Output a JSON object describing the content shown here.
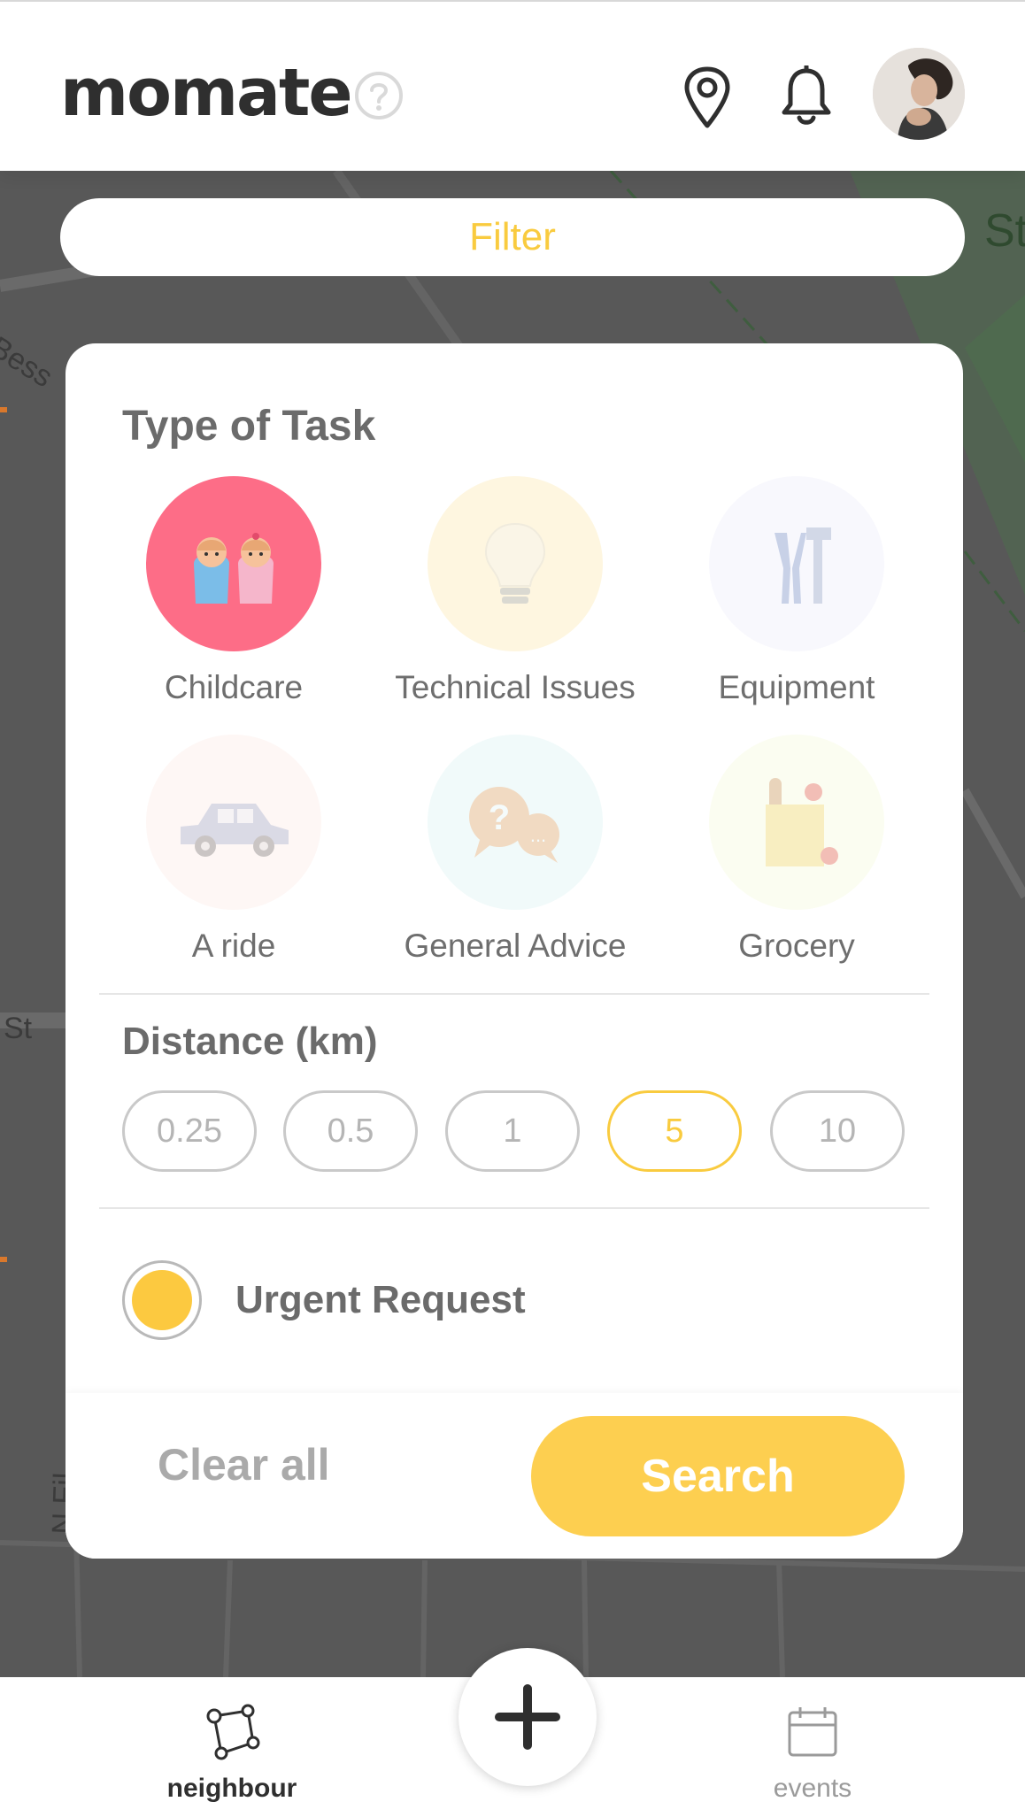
{
  "header": {
    "logo": "momate",
    "icons": [
      "help-icon",
      "location-pin-icon",
      "bell-icon",
      "avatar"
    ]
  },
  "map": {
    "labels": [
      "Bess",
      "St",
      "St",
      "N Fil"
    ]
  },
  "filter_bar": {
    "label": "Filter"
  },
  "filter_card": {
    "type_title": "Type of Task",
    "tasks": [
      {
        "label": "Childcare",
        "icon": "twin-babies-icon",
        "selected": true
      },
      {
        "label": "Technical Issues",
        "icon": "lightbulb-icon",
        "selected": false
      },
      {
        "label": "Equipment",
        "icon": "tools-icon",
        "selected": false
      },
      {
        "label": "A ride",
        "icon": "car-icon",
        "selected": false
      },
      {
        "label": "General Advice",
        "icon": "speech-bubbles-icon",
        "selected": false
      },
      {
        "label": "Grocery",
        "icon": "grocery-bag-icon",
        "selected": false
      }
    ],
    "distance_title": "Distance (km)",
    "distance_options": [
      "0.25",
      "0.5",
      "1",
      "5",
      "10"
    ],
    "distance_selected": "5",
    "urgent_label": "Urgent Request",
    "urgent_checked": true,
    "clear_label": "Clear all",
    "search_label": "Search"
  },
  "bottom_nav": {
    "items": [
      {
        "label": "neighbour",
        "icon": "neighbour-network-icon",
        "active": true
      },
      {
        "label": "events",
        "icon": "calendar-icon",
        "active": false
      }
    ],
    "fab_icon": "plus-icon"
  },
  "colors": {
    "accent": "#f9cb3f",
    "childcare_bg": "#fd6d87",
    "map_overlay": "#585858"
  }
}
